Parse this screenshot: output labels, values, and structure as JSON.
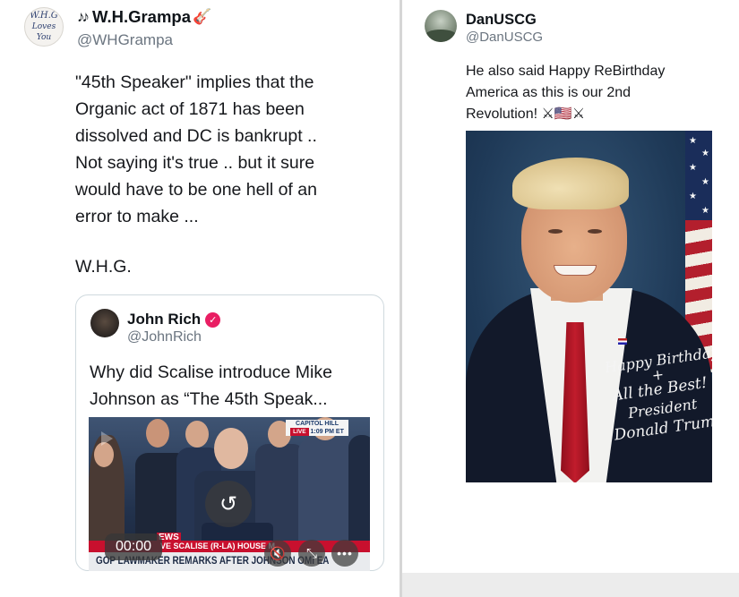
{
  "left_tweet": {
    "author_name": "W.H.Grampa",
    "name_prefix_emoji": "♪♪",
    "name_suffix_emoji": "🎸",
    "handle": "@WHGrampa",
    "avatar_text": [
      "W.H.G",
      "Loves",
      "You"
    ],
    "text_lines": [
      "\"45th Speaker\" implies that the",
      "Organic act of 1871 has been",
      "dissolved and DC is bankrupt ..",
      "Not saying it's true .. but it sure",
      "would have to be one hell of an",
      "error to make ..."
    ],
    "signature": "W.H.G.",
    "quoted": {
      "author_name": "John Rich",
      "handle": "@JohnRich",
      "text_lines": [
        "Why did Scalise introduce Mike",
        "Johnson as “The 45th Speak..."
      ],
      "video": {
        "time": "00:00",
        "capitol_badge": "CAPITOL HILL",
        "live_label": "LIVE",
        "live_time": "1:09 PM ET",
        "news_tag": "EWS",
        "chyron_top": "VE SCALISE (R-LA)  HOUSE M",
        "chyron_bottom": "GOP LAWMAKER REMARKS AFTER JOHNSON   OMI   EA"
      }
    }
  },
  "right_tweet": {
    "author_name": "DanUSCG",
    "handle": "@DanUSCG",
    "text_lines": [
      "He also said Happy ReBirthday",
      "America as this is our 2nd",
      "Revolution! ⚔🇺🇸⚔"
    ],
    "portrait_signature": [
      "Happy Birthday",
      "+",
      "All the Best!",
      "President",
      "Donald Trump"
    ]
  },
  "colors": {
    "verified_badge": "#e91e63",
    "news_red": "#c8102e",
    "handle_gray": "#6b7580"
  },
  "icons": {
    "replay": "↺",
    "mute": "🔇",
    "expand": "⤡",
    "more": "•••",
    "verified": "✓"
  }
}
